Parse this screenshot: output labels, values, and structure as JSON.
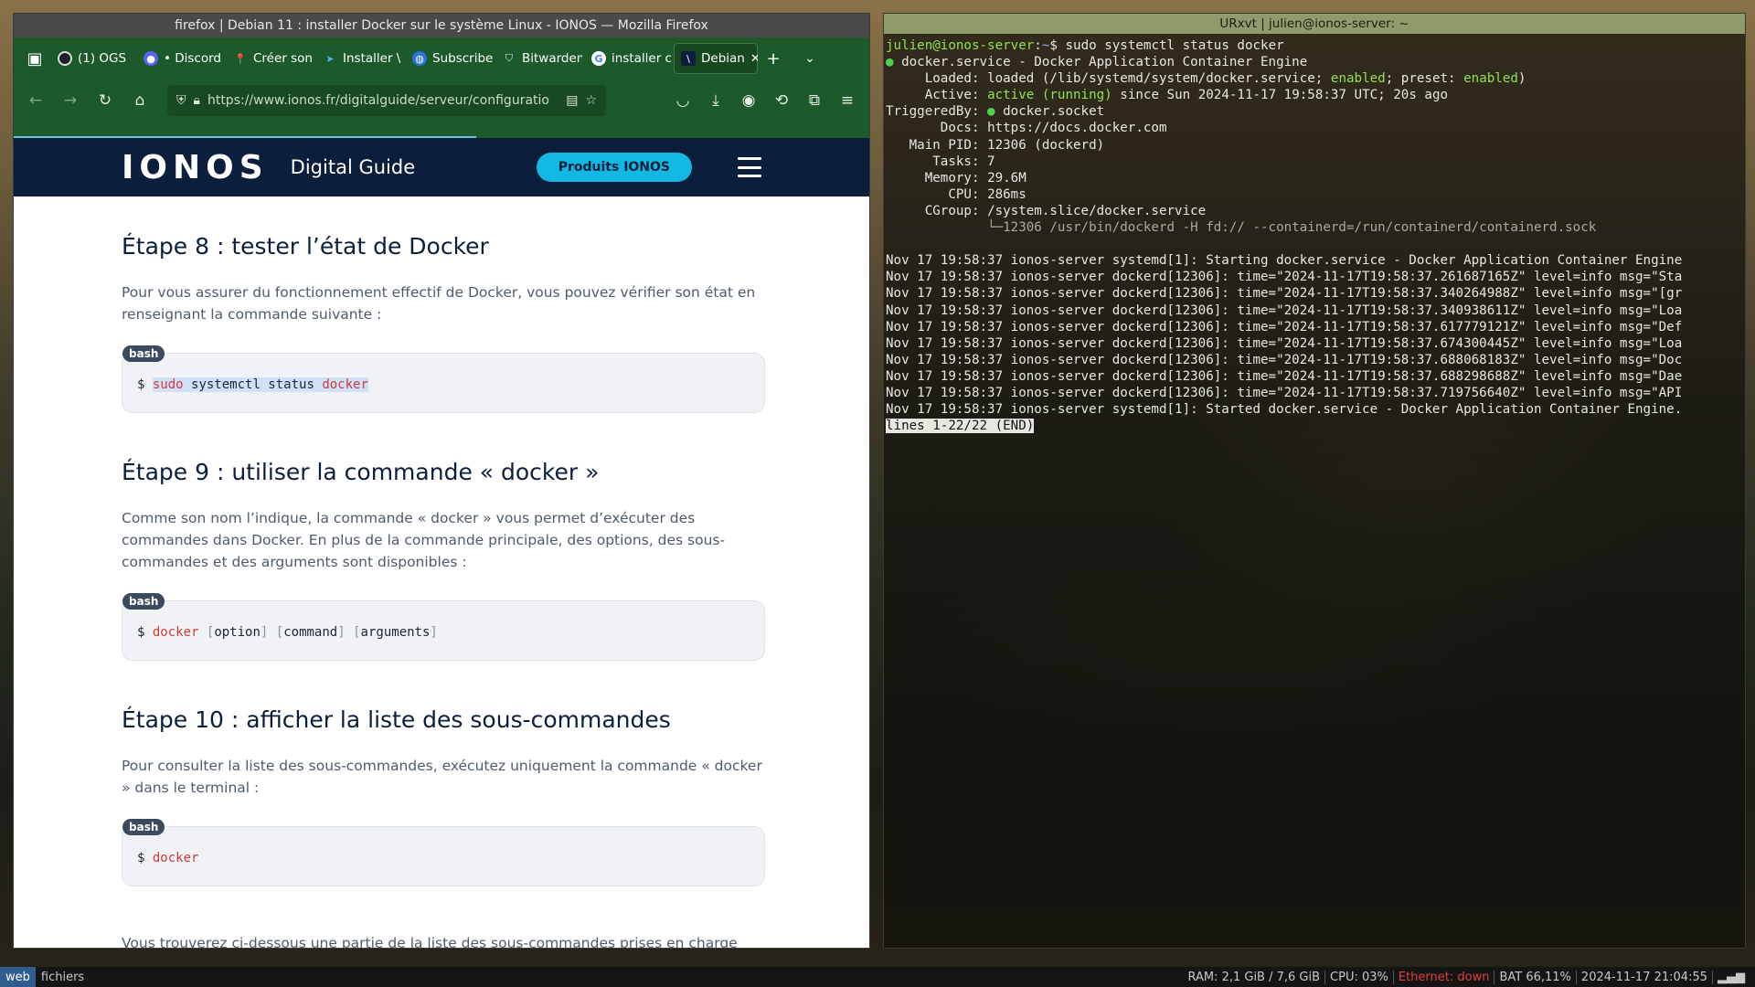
{
  "firefox": {
    "window_title": "firefox | Debian 11 : installer Docker sur le système Linux - IONOS — Mozilla Firefox",
    "tabs": [
      {
        "label": "(1) OGS",
        "icon": "ogs-icon"
      },
      {
        "label": "• Discord",
        "icon": "discord-icon"
      },
      {
        "label": "Créer son",
        "icon": "pin-icon"
      },
      {
        "label": "Installer \\",
        "icon": "arrow-icon"
      },
      {
        "label": "Subscribe",
        "icon": "globe-icon"
      },
      {
        "label": "Bitwarden",
        "icon": "bitwarden-icon"
      },
      {
        "label": "installer c",
        "icon": "google-icon"
      },
      {
        "label": "Debian",
        "icon": "ionos-icon"
      }
    ],
    "url": "https://www.ionos.fr/digitalguide/serveur/configuratio",
    "site": {
      "logo": "IONOS",
      "guide": "Digital Guide",
      "cta": "Produits IONOS"
    },
    "article": {
      "step8_title": "Étape 8 : tester l’état de Docker",
      "step8_text": "Pour vous assurer du fonctionnement effectif de Docker, vous pouvez vérifier son état en renseignant la commande suivante :",
      "step9_title": "Étape 9 : utiliser la commande « docker »",
      "step9_text": "Comme son nom l’indique, la commande « docker » vous permet d’exécuter des commandes dans Docker. En plus de la commande principale, des options, des sous-commandes et des arguments sont disponibles :",
      "step10_title": "Étape 10 : afficher la liste des sous-commandes",
      "step10_text": "Pour consulter la liste des sous-commandes, exécutez uniquement la commande « docker » dans le terminal :",
      "footer_text": "Vous trouverez ci-dessous une partie de la liste des sous-commandes prises en charge par la commande « docker » :",
      "code_lang": "bash",
      "prompt": "$",
      "code1": {
        "sudo": "sudo",
        "mid": " systemctl status ",
        "docker": "docker"
      },
      "code2": {
        "docker": "docker",
        "option": "option",
        "command": "command",
        "arguments": "arguments"
      },
      "code3": {
        "docker": "docker"
      }
    }
  },
  "terminal": {
    "title": "URxvt | julien@ionos-server: ~",
    "prompt_user": "julien@ionos-server",
    "prompt_path": "~",
    "command": "sudo systemctl status docker",
    "service_line": "docker.service - Docker Application Container Engine",
    "loaded": {
      "label": "Loaded:",
      "pre": "loaded (/lib/systemd/system/docker.service; ",
      "enabled1": "enabled",
      "mid": "; preset: ",
      "enabled2": "enabled",
      "post": ")"
    },
    "active": {
      "label": "Active:",
      "state": "active (running)",
      "rest": " since Sun 2024-11-17 19:58:37 UTC; 20s ago"
    },
    "triggered": {
      "label": "TriggeredBy:",
      "value": "docker.socket"
    },
    "docs": {
      "label": "Docs:",
      "value": "https://docs.docker.com"
    },
    "mainpid": {
      "label": "Main PID:",
      "value": "12306 (dockerd)"
    },
    "tasks": {
      "label": "Tasks:",
      "value": "7"
    },
    "memory": {
      "label": "Memory:",
      "value": "29.6M"
    },
    "cpu": {
      "label": "CPU:",
      "value": "286ms"
    },
    "cgroup": {
      "label": "CGroup:",
      "value": "/system.slice/docker.service"
    },
    "cgroup_child": "└─12306 /usr/bin/dockerd -H fd:// --containerd=/run/containerd/containerd.sock",
    "log_lines": [
      "Nov 17 19:58:37 ionos-server systemd[1]: Starting docker.service - Docker Application Container Engine",
      "Nov 17 19:58:37 ionos-server dockerd[12306]: time=\"2024-11-17T19:58:37.261687165Z\" level=info msg=\"Sta",
      "Nov 17 19:58:37 ionos-server dockerd[12306]: time=\"2024-11-17T19:58:37.340264988Z\" level=info msg=\"[gr",
      "Nov 17 19:58:37 ionos-server dockerd[12306]: time=\"2024-11-17T19:58:37.340938611Z\" level=info msg=\"Loa",
      "Nov 17 19:58:37 ionos-server dockerd[12306]: time=\"2024-11-17T19:58:37.617779121Z\" level=info msg=\"Def",
      "Nov 17 19:58:37 ionos-server dockerd[12306]: time=\"2024-11-17T19:58:37.674300445Z\" level=info msg=\"Loa",
      "Nov 17 19:58:37 ionos-server dockerd[12306]: time=\"2024-11-17T19:58:37.688068183Z\" level=info msg=\"Doc",
      "Nov 17 19:58:37 ionos-server dockerd[12306]: time=\"2024-11-17T19:58:37.688298688Z\" level=info msg=\"Dae",
      "Nov 17 19:58:37 ionos-server dockerd[12306]: time=\"2024-11-17T19:58:37.719756640Z\" level=info msg=\"API",
      "Nov 17 19:58:37 ionos-server systemd[1]: Started docker.service - Docker Application Container Engine."
    ],
    "pager_status": "lines 1-22/22 (END)"
  },
  "statusbar": {
    "workspaces": [
      "web",
      "fichiers"
    ],
    "ram": "RAM: 2,1 GiB / 7,6 GiB",
    "cpu": "CPU: 03%",
    "ethernet": "Ethernet: down",
    "battery": "BAT 66,11%",
    "datetime": "2024-11-17 21:04:55"
  },
  "colors": {
    "firefox_toolbar": "#1d5a2b",
    "ionos_navy": "#0b1e3b",
    "ionos_cyan": "#11b8e3",
    "terminal_green": "#8ee34e",
    "alert_red": "#e53b3b"
  }
}
